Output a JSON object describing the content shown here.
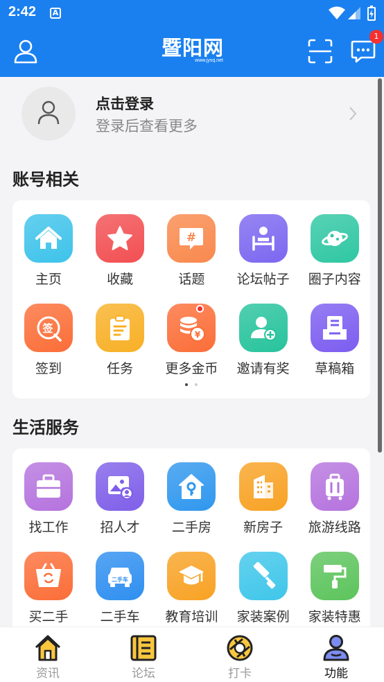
{
  "status_bar": {
    "time": "2:42",
    "a_icon": "A"
  },
  "header": {
    "logo_text": "暨阳网",
    "logo_url": "www.jysq.net",
    "message_badge": "1"
  },
  "login": {
    "title": "点击登录",
    "subtitle": "登录后查看更多"
  },
  "account_section": {
    "title": "账号相关",
    "items": [
      {
        "label": "主页",
        "icon": "home-icon",
        "color": "#3ec3ea"
      },
      {
        "label": "收藏",
        "icon": "star-icon",
        "color": "#f24f52"
      },
      {
        "label": "话题",
        "icon": "hashtag-icon",
        "color": "#f9894d"
      },
      {
        "label": "论坛帖子",
        "icon": "forum-icon",
        "color": "#7c67f0"
      },
      {
        "label": "圈子内容",
        "icon": "planet-icon",
        "color": "#2fc7a3"
      },
      {
        "label": "签到",
        "icon": "sign-in-icon",
        "color": "#fb6e38"
      },
      {
        "label": "任务",
        "icon": "clipboard-icon",
        "color": "#f8b026"
      },
      {
        "label": "更多金币",
        "icon": "coins-icon",
        "color": "#fb6e38"
      },
      {
        "label": "邀请有奖",
        "icon": "add-user-icon",
        "color": "#27c39c"
      },
      {
        "label": "草稿箱",
        "icon": "drafts-icon",
        "color": "#7c5df0"
      }
    ]
  },
  "life_section": {
    "title": "生活服务",
    "items": [
      {
        "label": "找工作",
        "icon": "briefcase-icon",
        "color": "#b573de"
      },
      {
        "label": "招人才",
        "icon": "recruit-icon",
        "color": "#7f5fe9"
      },
      {
        "label": "二手房",
        "icon": "house-key-icon",
        "color": "#2f97ee"
      },
      {
        "label": "新房子",
        "icon": "building-icon",
        "color": "#f8a224"
      },
      {
        "label": "旅游线路",
        "icon": "luggage-icon",
        "color": "#b573de"
      },
      {
        "label": "买二手",
        "icon": "basket-icon",
        "color": "#fb6e38"
      },
      {
        "label": "二手车",
        "icon": "car-icon",
        "color": "#2f8ff0"
      },
      {
        "label": "教育培训",
        "icon": "graduation-icon",
        "color": "#f8a224"
      },
      {
        "label": "家装案例",
        "icon": "paint-roller-icon",
        "color": "#3fc6ea"
      },
      {
        "label": "家装特惠",
        "icon": "roller-icon",
        "color": "#5cc45c"
      }
    ]
  },
  "car_text": "二手车",
  "sign_text": "签",
  "bottom_nav": [
    {
      "label": "资讯",
      "icon": "house-nav-icon",
      "active": false
    },
    {
      "label": "论坛",
      "icon": "book-nav-icon",
      "active": false
    },
    {
      "label": "打卡",
      "icon": "aperture-nav-icon",
      "active": false
    },
    {
      "label": "功能",
      "icon": "user-nav-icon",
      "active": true
    }
  ]
}
